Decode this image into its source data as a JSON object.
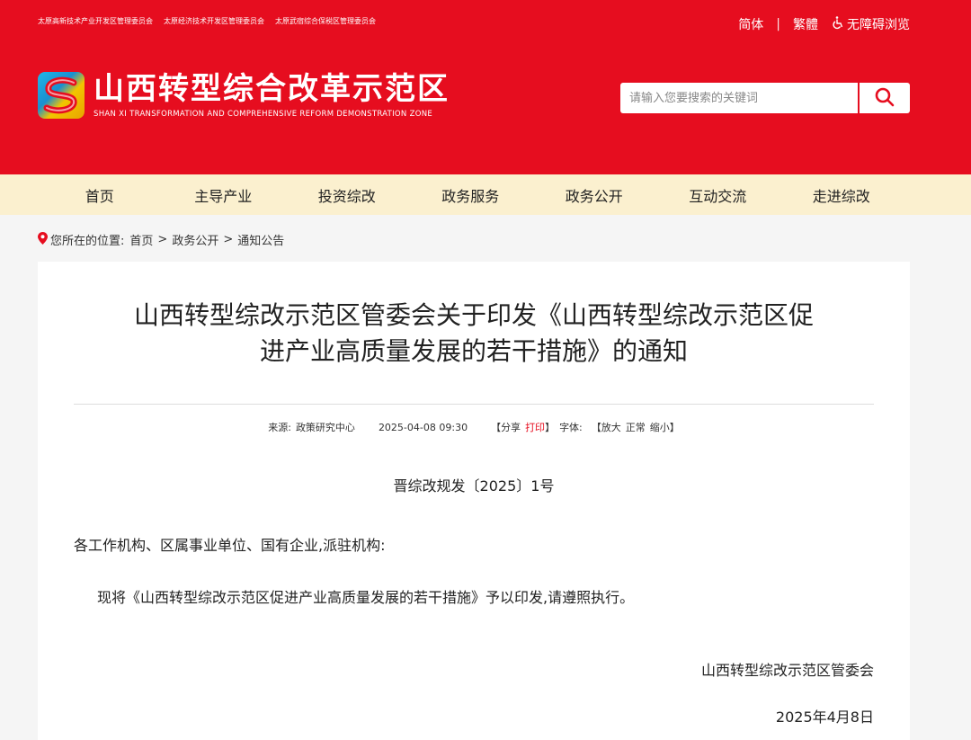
{
  "header": {
    "top_links": [
      "太原高新技术产业开发区管理委员会",
      "太原经济技术开发区管理委员会",
      "太原武宿综合保税区管理委员会"
    ],
    "lang_simplified": "简体",
    "lang_sep": "|",
    "lang_traditional": "繁體",
    "accessibility": "无障碍浏览",
    "logo_cn": "山西转型综合改革示范区",
    "logo_en": "SHAN XI TRANSFORMATION AND COMPREHENSIVE REFORM DEMONSTRATION ZONE",
    "search_placeholder": "请输入您要搜索的关键词"
  },
  "nav": [
    "首页",
    "主导产业",
    "投资综改",
    "政务服务",
    "政务公开",
    "互动交流",
    "走进综改"
  ],
  "breadcrumb": {
    "label": "您所在的位置:",
    "items": [
      "首页",
      "政务公开",
      "通知公告"
    ],
    "sep": ">"
  },
  "article": {
    "title_line1": "山西转型综改示范区管委会关于印发《山西转型综改示范区促",
    "title_line2": "进产业高质量发展的若干措施》的通知",
    "source_label": "来源:",
    "source": "政策研究中心",
    "datetime": "2025-04-08 09:30",
    "bracket_open": "【",
    "share": "分享",
    "print": "打印",
    "bracket_close": "】",
    "font_label": "字体:",
    "font_large": "放大",
    "font_normal": "正常",
    "font_small": "缩小",
    "doc_number": "晋综改规发〔2025〕1号",
    "salutation": "各工作机构、区属事业单位、国有企业,派驻机构:",
    "body": "现将《山西转型综改示范区促进产业高质量发展的若干措施》予以印发,请遵照执行。",
    "signature": "山西转型综改示范区管委会",
    "date": "2025年4月8日"
  },
  "colors": {
    "brand_red": "#e60d1f",
    "nav_bg": "#fbf0cf"
  }
}
